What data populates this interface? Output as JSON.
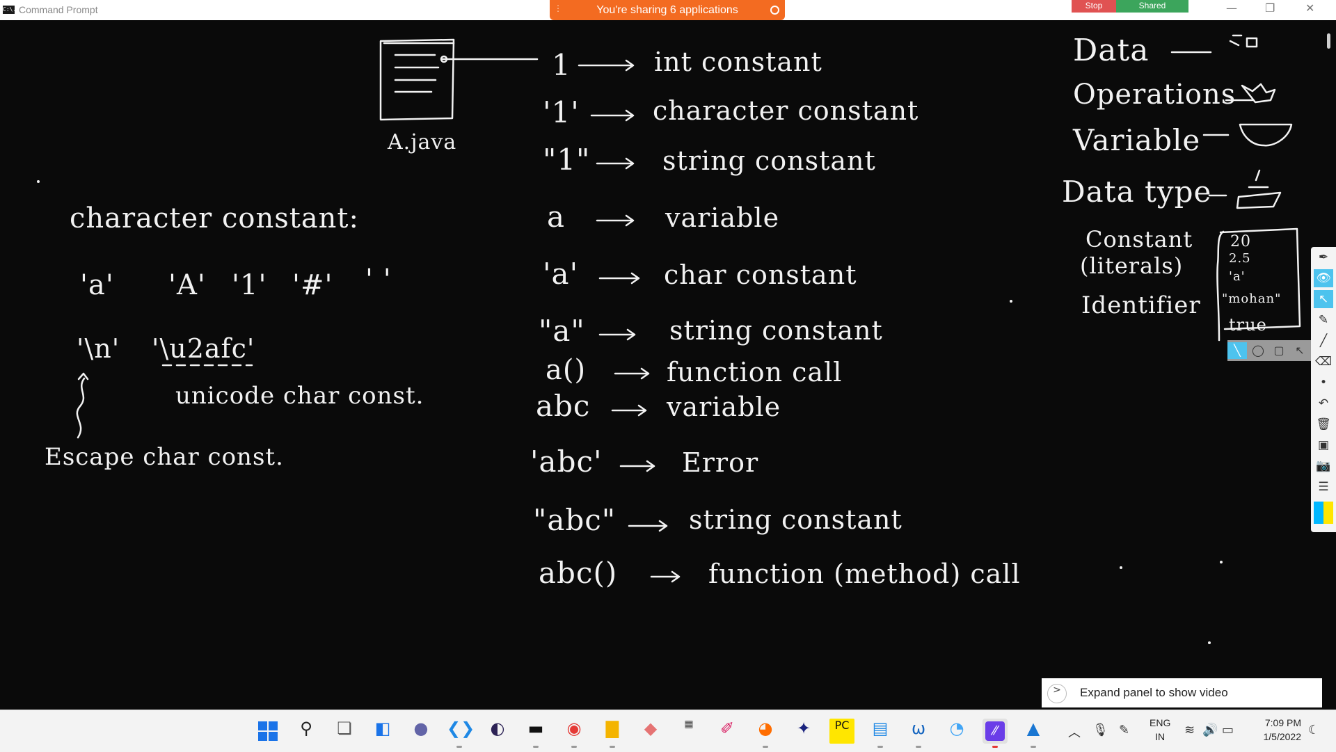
{
  "window": {
    "title": "Command Prompt",
    "icon_text": "C:\\."
  },
  "share": {
    "text": "You're sharing 6 applications",
    "stop": "Stop",
    "shared": "Shared"
  },
  "window_controls": {
    "minimize": "—",
    "restore": "❐",
    "close": "✕"
  },
  "whiteboard": {
    "file_label": "A.java",
    "left_title": "character constant:",
    "char_examples": [
      "'a'",
      "'A'",
      "'1'",
      "'#'",
      "' '"
    ],
    "escape_examples": [
      "'\\n'",
      "'\\u2afc'"
    ],
    "unicode_note": "unicode char const.",
    "escape_note": "Escape char const.",
    "mapping": [
      {
        "lhs": "1",
        "rhs": "int constant"
      },
      {
        "lhs": "'1'",
        "rhs": "character constant"
      },
      {
        "lhs": "\"1\"",
        "rhs": "string constant"
      },
      {
        "lhs": "a",
        "rhs": "variable"
      },
      {
        "lhs": "'a'",
        "rhs": "char constant"
      },
      {
        "lhs": "\"a\"",
        "rhs": "string constant"
      },
      {
        "lhs": "a()",
        "rhs": "function call"
      },
      {
        "lhs": "abc",
        "rhs": "variable"
      },
      {
        "lhs": "'abc'",
        "rhs": "Error"
      },
      {
        "lhs": "\"abc\"",
        "rhs": "string constant"
      },
      {
        "lhs": "abc()",
        "rhs": "function (method) call"
      }
    ],
    "right_terms": [
      "Data",
      "Operations",
      "Variable",
      "Data type"
    ],
    "constant_label": "Constant",
    "literals_label": "(literals)",
    "identifier_label": "Identifier",
    "literal_values": [
      "20",
      "2.5",
      "'a'",
      "\"mohan\"",
      "true"
    ]
  },
  "tools": [
    "pen-icon",
    "eye-icon",
    "cursor-icon",
    "highlighter-icon",
    "line-icon",
    "eraser-icon",
    "dot-icon",
    "undo-icon",
    "trash-icon",
    "whiteboard-icon",
    "camera-icon",
    "notes-icon",
    "color-icon"
  ],
  "expand_panel": {
    "arrow": ">",
    "text": "Expand panel to show video"
  },
  "taskbar": {
    "apps": [
      "start-icon",
      "search-icon",
      "task-view-icon",
      "widgets-icon",
      "chat-icon",
      "vscode-icon",
      "eclipse-icon",
      "terminal-icon",
      "chrome-icon",
      "file-explorer-icon",
      "pencil-app-icon",
      "mysql-icon",
      "brush-icon",
      "firefox-icon",
      "game-icon",
      "pycharm-icon",
      "notepad-icon",
      "webex-icon",
      "paint-icon",
      "epic-pen-icon",
      "photos-icon"
    ],
    "lang_top": "ENG",
    "lang_bottom": "IN",
    "time": "7:09 PM",
    "date": "1/5/2022"
  }
}
